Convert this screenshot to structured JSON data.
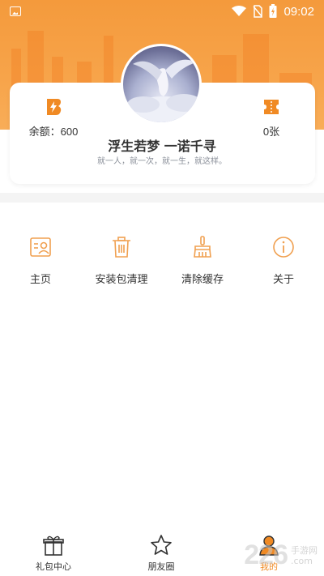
{
  "status_bar": {
    "time": "09:02"
  },
  "profile": {
    "nickname": "浮生若梦 一诺千寻",
    "signature": "就一人，就一次，就一生，就这样。",
    "balance": "余额：600",
    "tickets": "0张"
  },
  "menu": [
    {
      "label": "主页",
      "icon": "profile-card-icon"
    },
    {
      "label": "安装包清理",
      "icon": "trash-icon"
    },
    {
      "label": "清除缓存",
      "icon": "broom-icon"
    },
    {
      "label": "关于",
      "icon": "info-icon"
    }
  ],
  "tabs": [
    {
      "label": "礼包中心",
      "icon": "gift-icon"
    },
    {
      "label": "朋友圈",
      "icon": "star-icon"
    },
    {
      "label": "我的",
      "icon": "user-icon",
      "active": true
    }
  ],
  "watermark": {
    "brand": "226",
    "text_line1": "手游网",
    "text_line2": ".com"
  },
  "colors": {
    "accent": "#f08a24",
    "header": "#f49a3c"
  }
}
